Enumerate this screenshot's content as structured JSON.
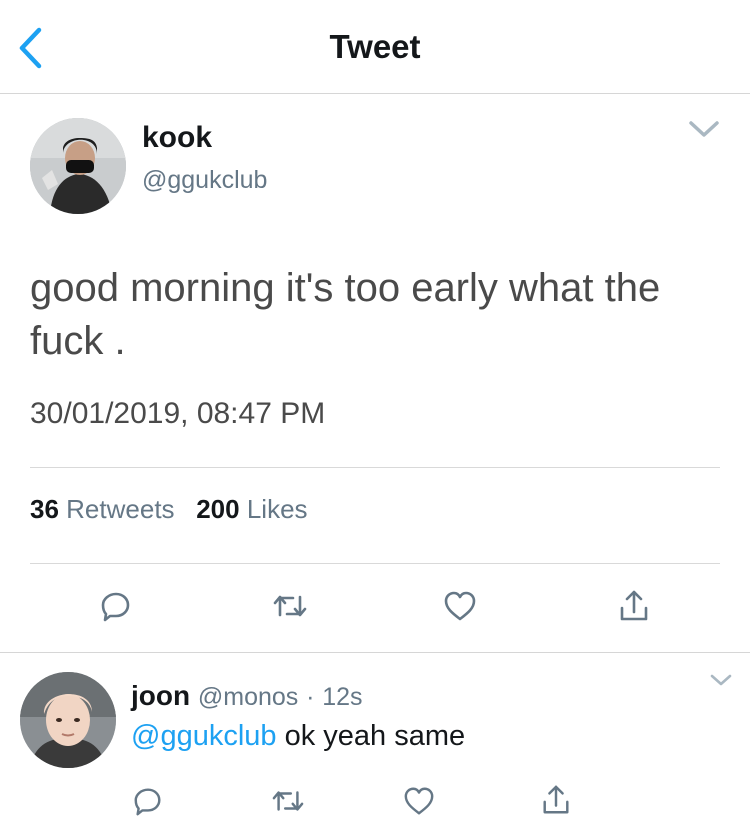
{
  "header": {
    "title": "Tweet"
  },
  "tweet": {
    "display_name": "kook",
    "handle": "@ggukclub",
    "text": "good morning it's too early what the fuck .",
    "timestamp": "30/01/2019, 08:47 PM",
    "retweets_count": "36",
    "retweets_label": "Retweets",
    "likes_count": "200",
    "likes_label": "Likes"
  },
  "reply": {
    "display_name": "joon",
    "handle": "@monos",
    "separator": "·",
    "time": "12s",
    "mention": "@ggukclub",
    "text": "ok yeah same"
  },
  "colors": {
    "accent": "#1da1f2",
    "icon_gray": "#657786",
    "text_dark": "#14171a",
    "divider": "#d9d9d9"
  },
  "icons": [
    "back-chevron-icon",
    "chevron-down-icon",
    "reply-icon",
    "retweet-icon",
    "like-icon",
    "share-icon"
  ]
}
